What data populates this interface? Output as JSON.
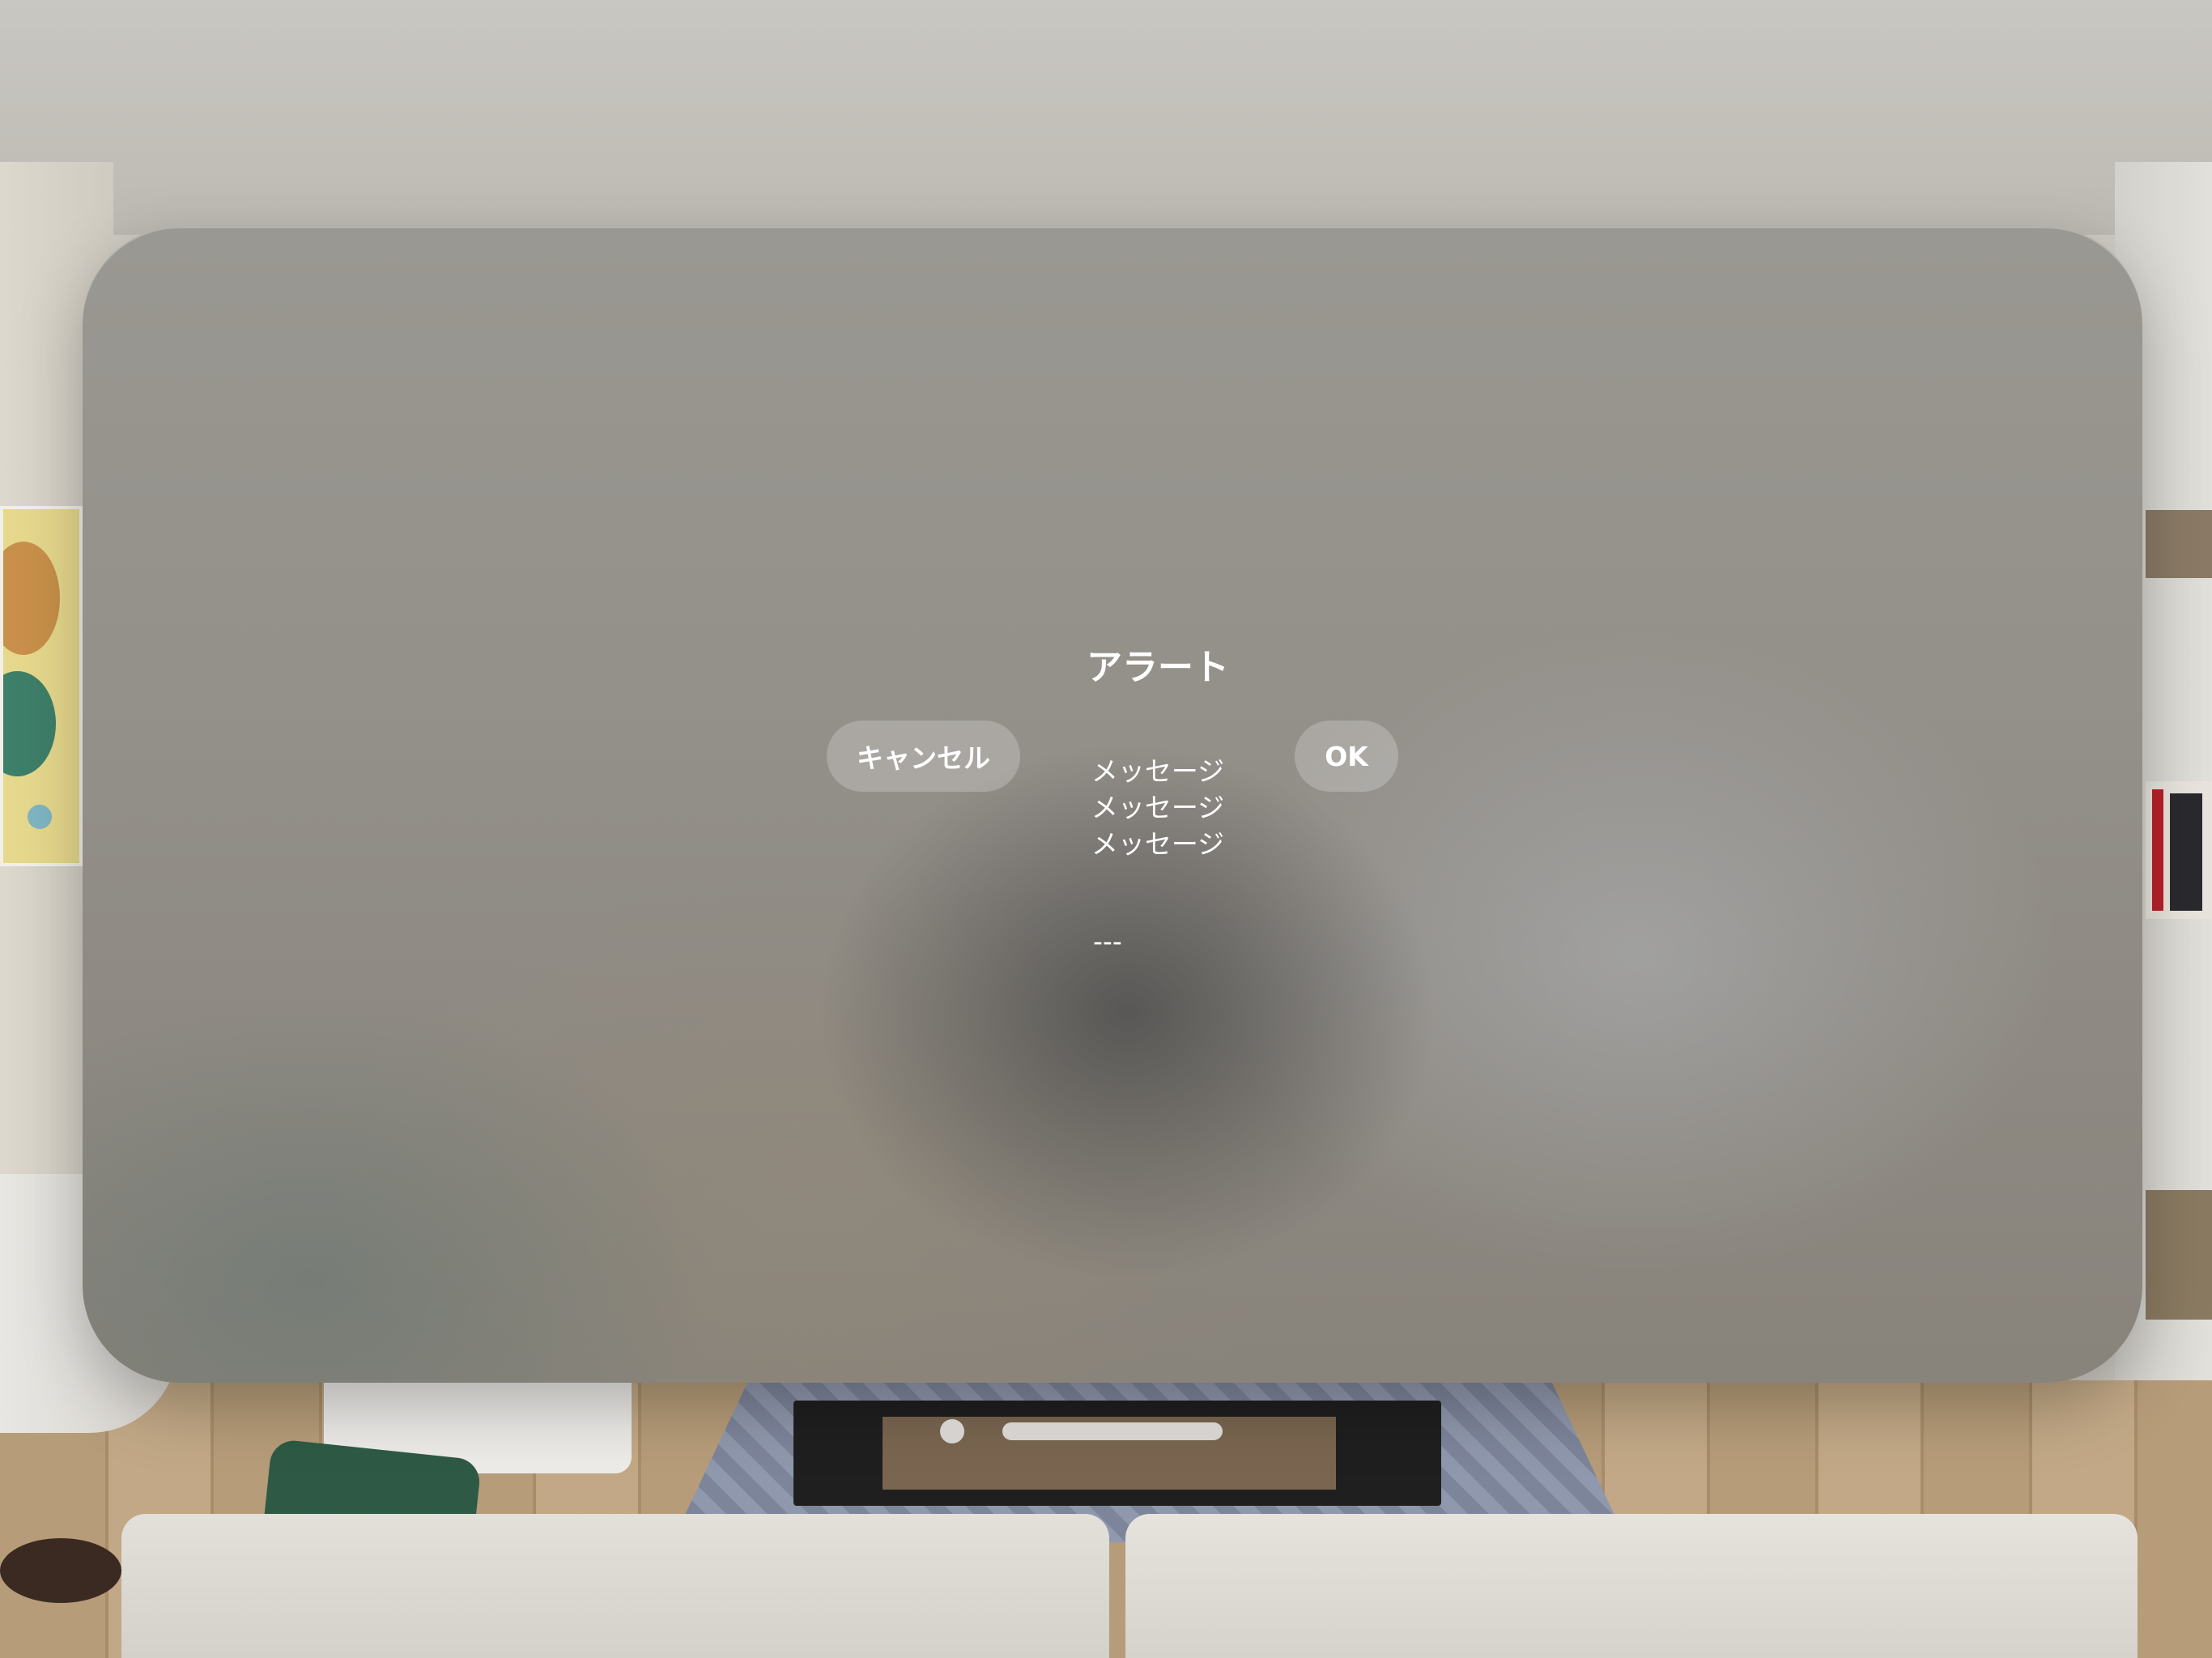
{
  "alert": {
    "title": "アラート",
    "message_lines": [
      "メッセージ",
      "メッセージ",
      "メッセージ"
    ],
    "separator": "---",
    "cancel_label": "キャンセル",
    "ok_label": "OK"
  },
  "colors": {
    "glass": "#938f89",
    "button_fill": "rgba(255,255,255,0.22)",
    "text": "#ffffff"
  }
}
